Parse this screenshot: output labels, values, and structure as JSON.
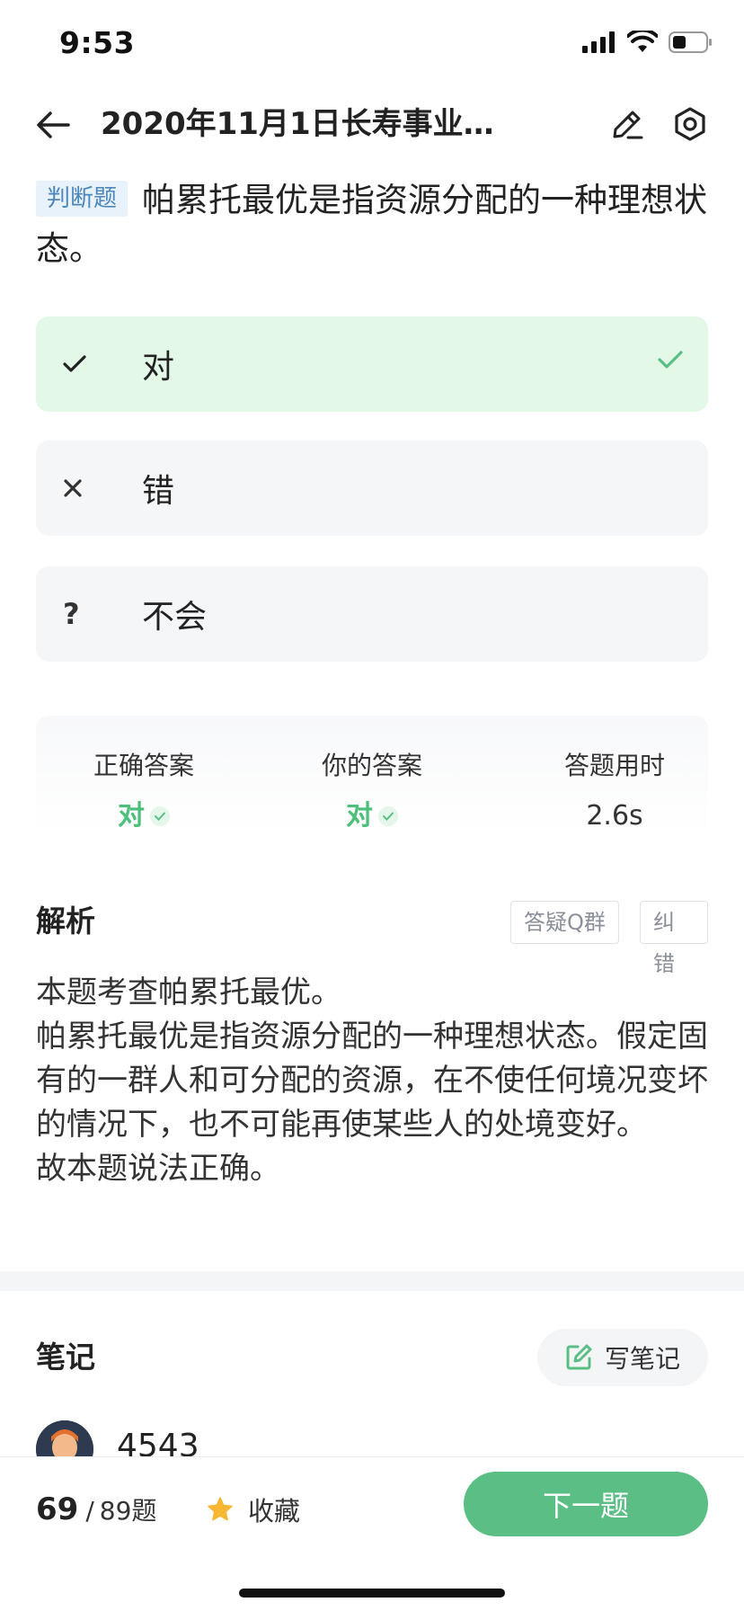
{
  "status_bar": {
    "time": "9:53"
  },
  "nav": {
    "title": "2020年11月1日长寿事业单…"
  },
  "question": {
    "type_tag": "判断题",
    "text": "帕累托最优是指资源分配的一种理想状态。"
  },
  "options": [
    {
      "mark": "✓",
      "label": "对",
      "state": "correct"
    },
    {
      "mark": "×",
      "label": "错",
      "state": "normal"
    },
    {
      "mark": "?",
      "label": "不会",
      "state": "normal"
    }
  ],
  "stats": {
    "correct_answer": {
      "title": "正确答案",
      "value": "对"
    },
    "your_answer": {
      "title": "你的答案",
      "value": "对"
    },
    "time_used": {
      "title": "答题用时",
      "value": "2.6s"
    }
  },
  "analysis": {
    "title": "解析",
    "qq_group_label": "答疑Q群",
    "correct_error_label": "纠错",
    "lines": [
      "本题考查帕累托最优。",
      "帕累托最优是指资源分配的一种理想状态。假定固有的一群人和可分配的资源，在不使任何境况变坏的情况下，也不可能再使某些人的处境变好。",
      "故本题说法正确。"
    ]
  },
  "notes": {
    "title": "笔记",
    "write_label": "写笔记",
    "first_user": "4543"
  },
  "bottom": {
    "current": "69",
    "separator": "/",
    "total": "89",
    "unit": "题",
    "favorite_label": "收藏",
    "next_label": "下一题"
  },
  "colors": {
    "green": "#5bbf85",
    "correct_bg": "#e3f8e7",
    "option_bg": "#f5f6f8",
    "tag_bg": "#e7f2fb",
    "tag_text": "#4d86b8",
    "star": "#f7b733"
  }
}
